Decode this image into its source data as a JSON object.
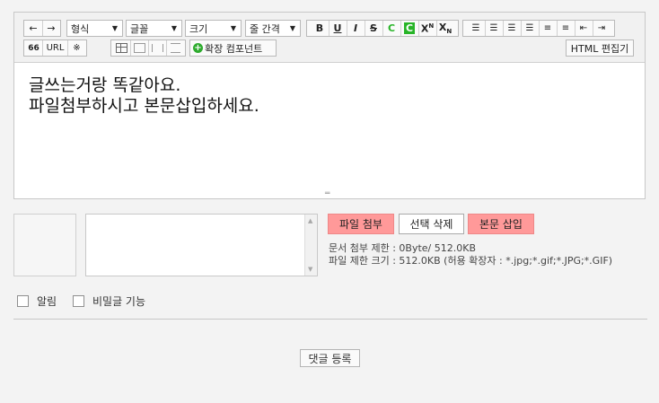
{
  "toolbar": {
    "undo_icon": "←",
    "redo_icon": "→",
    "format_label": "형식",
    "font_label": "글꼴",
    "size_label": "크기",
    "line_spacing_label": "줄 간격",
    "bold_label": "B",
    "underline_label": "U",
    "italic_label": "I",
    "strike_label": "S",
    "text_color_label": "C",
    "bg_color_label": "C",
    "superscript_label": "X",
    "superscript_mark": "N",
    "subscript_label": "X",
    "subscript_mark": "N",
    "quote_label": "66",
    "url_label": "URL",
    "special_char_label": "※",
    "extend_component_label": "확장 컴포넌트",
    "html_edit_label": "HTML 편집기",
    "text_color_hex": "#27b427",
    "bg_color_hex": "#27b427"
  },
  "editor": {
    "line1": "글쓰는거랑 똑같아요.",
    "line2": "파일첨부하시고 본문삽입하세요."
  },
  "attach": {
    "attach_button": "파일 첨부",
    "delete_button": "선택 삭제",
    "insert_button": "본문 삽입",
    "doc_limit": "문서 첨부 제한 : 0Byte/ 512.0KB",
    "file_limit": "파일 제한 크기 : 512.0KB (허용 확장자 : *.jpg;*.gif;*.JPG;*.GIF)"
  },
  "options": {
    "notify_label": "알림",
    "secret_label": "비밀글 기능"
  },
  "submit_label": "댓글 등록"
}
